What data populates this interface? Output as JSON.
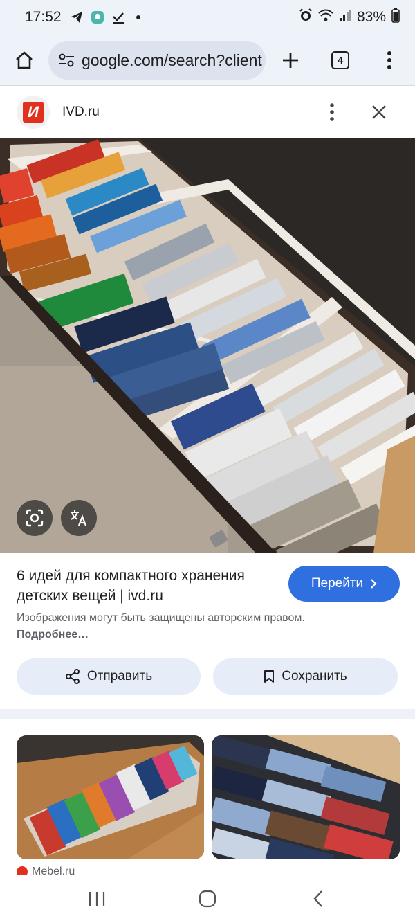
{
  "status_bar": {
    "time": "17:52",
    "battery": "83%"
  },
  "browser": {
    "url": "google.com/search?client",
    "tab_count": "4"
  },
  "source": {
    "favicon_letter": "И",
    "name": "IVD.ru"
  },
  "result": {
    "title": "6 идей для компактного хранения детских вещей | ivd.ru",
    "goto_label": "Перейти",
    "copyright_text": "Изображения могут быть защищены авторским правом.",
    "more_link": "Подробнее…",
    "share_label": "Отправить",
    "save_label": "Сохранить"
  },
  "related": {
    "first_source": "Mebel.ru"
  },
  "colors": {
    "accent": "#2f6fe0",
    "chip_bg": "#e6edf8",
    "toolbar_bg": "#eef2f9",
    "brand_red": "#e0301e"
  },
  "icons": [
    "home-icon",
    "site-settings-icon",
    "plus-icon",
    "tabs-icon",
    "more-vert-icon",
    "close-icon",
    "google-lens-icon",
    "translate-icon",
    "chevron-right-icon",
    "share-icon",
    "bookmark-icon",
    "recent-apps-icon",
    "home-nav-icon",
    "back-icon"
  ]
}
